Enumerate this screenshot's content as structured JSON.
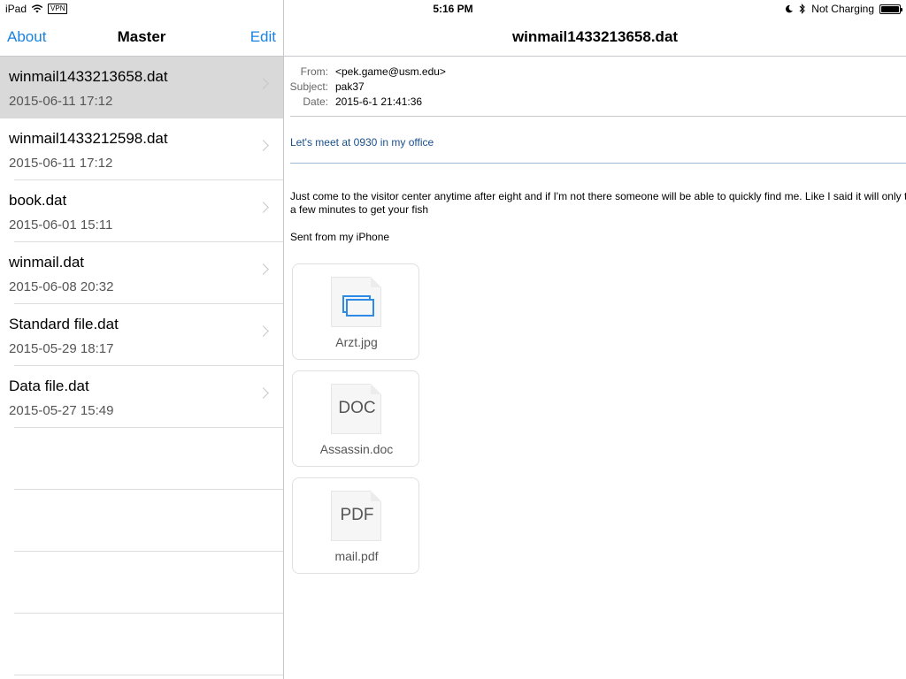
{
  "status_bar": {
    "device": "iPad",
    "vpn": "VPN",
    "time": "5:16 PM",
    "charging": "Not Charging",
    "battery_level": 1.0
  },
  "master": {
    "nav": {
      "left": "About",
      "title": "Master",
      "right": "Edit"
    },
    "items": [
      {
        "title": "winmail1433213658.dat",
        "date": "2015-06-11 17:12",
        "selected": true
      },
      {
        "title": "winmail1433212598.dat",
        "date": "2015-06-11 17:12",
        "selected": false
      },
      {
        "title": "book.dat",
        "date": "2015-06-01 15:11",
        "selected": false
      },
      {
        "title": "winmail.dat",
        "date": "2015-06-08 20:32",
        "selected": false
      },
      {
        "title": "Standard file.dat",
        "date": "2015-05-29 18:17",
        "selected": false
      },
      {
        "title": "Data file.dat",
        "date": "2015-05-27 15:49",
        "selected": false
      }
    ]
  },
  "detail": {
    "title": "winmail1433213658.dat",
    "headers": {
      "from_label": "From:",
      "from": "<pek.game@usm.edu>",
      "subject_label": "Subject:",
      "subject": "pak37",
      "date_label": "Date:",
      "date": "2015-6-1 21:41:36"
    },
    "subject_line": "Let's meet at 0930 in my office",
    "body": "Just come to the visitor center anytime after eight and if I'm not there someone will be able to quickly find me. Like I said it will only take a few minutes to get your fish",
    "sent_from": "Sent from my iPhone",
    "attachments": [
      {
        "name": "Arzt.jpg",
        "type": "",
        "icon": "image-icon"
      },
      {
        "name": "Assassin.doc",
        "type": "DOC",
        "icon": "doc-file-icon"
      },
      {
        "name": "mail.pdf",
        "type": "PDF",
        "icon": "pdf-file-icon"
      }
    ]
  },
  "colors": {
    "accent": "#1a82e2",
    "selected_row": "#d9d9d9",
    "link_text": "#1a4f8a"
  }
}
